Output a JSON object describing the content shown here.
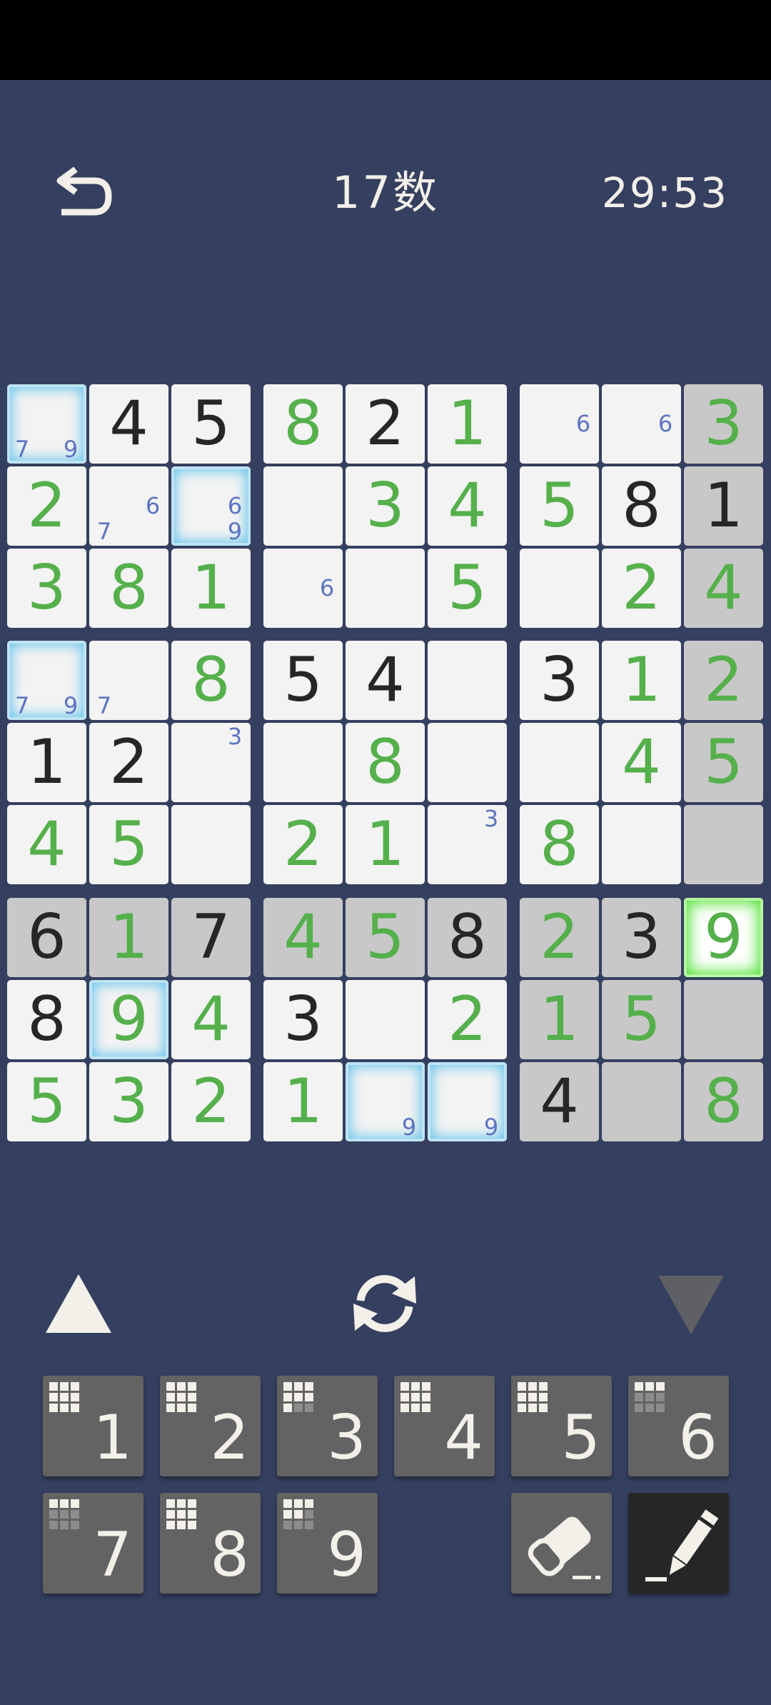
{
  "header": {
    "title": "17数",
    "timer": "29:53"
  },
  "grid": {
    "rows": [
      [
        "",
        "4",
        "5",
        "8",
        "2",
        "1",
        "",
        "",
        "3"
      ],
      [
        "2",
        "",
        "",
        "",
        "3",
        "4",
        "5",
        "8",
        "1"
      ],
      [
        "3",
        "8",
        "1",
        "",
        "",
        "5",
        "",
        "2",
        "4"
      ],
      [
        "",
        "",
        "8",
        "5",
        "4",
        "",
        "3",
        "1",
        "2"
      ],
      [
        "1",
        "2",
        "",
        "",
        "8",
        "",
        "",
        "4",
        "5"
      ],
      [
        "4",
        "5",
        "",
        "2",
        "1",
        "",
        "8",
        "",
        ""
      ],
      [
        "6",
        "1",
        "7",
        "4",
        "5",
        "8",
        "2",
        "3",
        "9"
      ],
      [
        "8",
        "9",
        "4",
        "3",
        "",
        "2",
        "1",
        "5",
        ""
      ],
      [
        "5",
        "3",
        "2",
        "1",
        "",
        "",
        "4",
        "",
        "8"
      ]
    ],
    "kinds": [
      [
        "",
        "g",
        "g",
        "u",
        "g",
        "u",
        "",
        "",
        "u"
      ],
      [
        "u",
        "",
        "",
        "",
        "u",
        "u",
        "u",
        "g",
        "g"
      ],
      [
        "u",
        "u",
        "u",
        "",
        "",
        "u",
        "",
        "u",
        "u"
      ],
      [
        "",
        "",
        "u",
        "g",
        "g",
        "",
        "g",
        "u",
        "u"
      ],
      [
        "g",
        "g",
        "",
        "",
        "u",
        "",
        "",
        "u",
        "u"
      ],
      [
        "u",
        "u",
        "",
        "u",
        "u",
        "",
        "u",
        "",
        ""
      ],
      [
        "g",
        "u",
        "g",
        "u",
        "u",
        "g",
        "u",
        "g",
        "u"
      ],
      [
        "g",
        "u",
        "u",
        "g",
        "",
        "u",
        "u",
        "u",
        ""
      ],
      [
        "u",
        "u",
        "u",
        "u",
        "",
        "",
        "g",
        "",
        "u"
      ]
    ],
    "notes": [
      {
        "r": 0,
        "c": 0,
        "digits": [
          "7",
          "9"
        ]
      },
      {
        "r": 0,
        "c": 6,
        "digits": [
          "6"
        ]
      },
      {
        "r": 0,
        "c": 7,
        "digits": [
          "6"
        ]
      },
      {
        "r": 1,
        "c": 1,
        "digits": [
          "6",
          "7"
        ]
      },
      {
        "r": 1,
        "c": 2,
        "digits": [
          "6",
          "9"
        ]
      },
      {
        "r": 2,
        "c": 3,
        "digits": [
          "6"
        ]
      },
      {
        "r": 3,
        "c": 0,
        "digits": [
          "7",
          "9"
        ]
      },
      {
        "r": 3,
        "c": 1,
        "digits": [
          "7"
        ]
      },
      {
        "r": 4,
        "c": 2,
        "digits": [
          "3"
        ]
      },
      {
        "r": 5,
        "c": 5,
        "digits": [
          "3"
        ]
      },
      {
        "r": 8,
        "c": 4,
        "digits": [
          "9"
        ]
      },
      {
        "r": 8,
        "c": 5,
        "digits": [
          "9"
        ]
      }
    ],
    "shaded_rows": [
      6
    ],
    "shaded_cols": [
      8
    ],
    "shaded_extra": [
      {
        "r": 7,
        "c": 6
      },
      {
        "r": 7,
        "c": 7
      },
      {
        "r": 8,
        "c": 6
      },
      {
        "r": 8,
        "c": 7
      }
    ],
    "selected_cells": [
      {
        "r": 0,
        "c": 0
      },
      {
        "r": 1,
        "c": 2
      },
      {
        "r": 3,
        "c": 0
      },
      {
        "r": 7,
        "c": 1
      },
      {
        "r": 8,
        "c": 4
      },
      {
        "r": 8,
        "c": 5
      }
    ],
    "focused_cell": {
      "r": 6,
      "c": 8
    },
    "colors": {
      "given": "#262626",
      "user": "#55b04c",
      "note": "#5d74c0"
    }
  },
  "keypad": [
    {
      "label": "1",
      "remaining": 0
    },
    {
      "label": "2",
      "remaining": 0
    },
    {
      "label": "3",
      "remaining": 2
    },
    {
      "label": "4",
      "remaining": 0
    },
    {
      "label": "5",
      "remaining": 0
    },
    {
      "label": "6",
      "remaining": 6
    },
    {
      "label": "7",
      "remaining": 6
    },
    {
      "label": "8",
      "remaining": 0
    },
    {
      "label": "9",
      "remaining": 4
    }
  ],
  "tools": {
    "eraser_icon": "eraser-icon",
    "pencil_icon": "pencil-icon"
  }
}
